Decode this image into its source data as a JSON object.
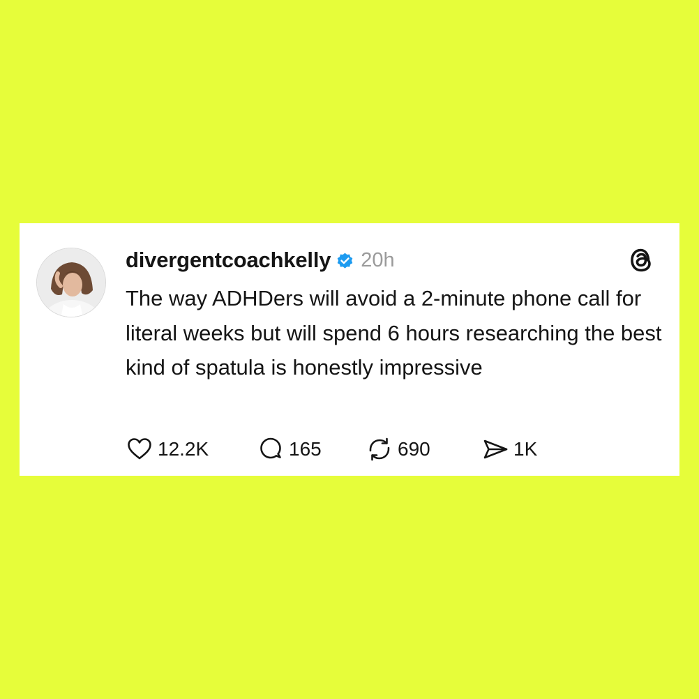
{
  "colors": {
    "background": "#e6fd3a",
    "card": "#ffffff",
    "text": "#151515",
    "muted": "#9b9b9b",
    "verified": "#1d9bf0"
  },
  "post": {
    "username": "divergentcoachkelly",
    "verified_icon": "verified-badge-icon",
    "timestamp": "20h",
    "text": "The way ADHDers will avoid a 2-minute phone call for literal weeks but will spend 6 hours researching the best kind of spatula is honestly impressive"
  },
  "actions": {
    "likes": "12.2K",
    "replies": "165",
    "reposts": "690",
    "shares": "1K"
  },
  "icons": {
    "logo": "threads-logo-icon",
    "like": "heart-icon",
    "reply": "speech-bubble-icon",
    "repost": "repost-icon",
    "share": "paper-plane-icon"
  }
}
